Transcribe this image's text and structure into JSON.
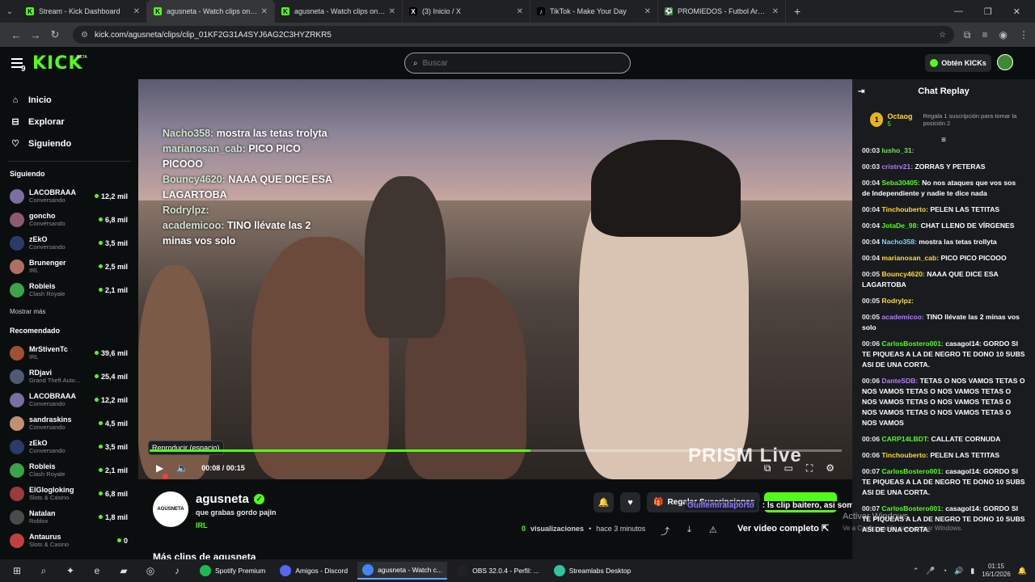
{
  "browser": {
    "tabs": [
      {
        "title": "Stream - Kick Dashboard",
        "fav_color": "#53fc18",
        "fav": "K"
      },
      {
        "title": "agusneta - Watch clips on Kick",
        "fav_color": "#53fc18",
        "fav": "K",
        "active": true
      },
      {
        "title": "agusneta - Watch clips on Kick",
        "fav_color": "#53fc18",
        "fav": "K"
      },
      {
        "title": "(3) Inicio / X",
        "fav_color": "#000000",
        "fav": "X"
      },
      {
        "title": "TikTok - Make Your Day",
        "fav_color": "#000000",
        "fav": "♪"
      },
      {
        "title": "PROMIEDOS - Futbol Argentino",
        "fav_color": "#2e9c3e",
        "fav": "⚽"
      }
    ],
    "url": "kick.com/agusneta/clips/clip_01KF2G31A4SYJ6AG2C3HYZRKR5"
  },
  "header": {
    "logo": "KICK",
    "beta": "BETA",
    "logo_num": "9",
    "search_placeholder": "Buscar",
    "kicks_label": "Obtén KICKs"
  },
  "sidebar": {
    "nav": [
      {
        "label": "Inicio",
        "icon": "home-icon",
        "glyph": "⌂"
      },
      {
        "label": "Explorar",
        "icon": "compass-icon",
        "glyph": "⊟"
      },
      {
        "label": "Siguiendo",
        "icon": "heart-icon",
        "glyph": "♡"
      }
    ],
    "following_title": "Siguiendo",
    "following": [
      {
        "name": "LACOBRAAA",
        "category": "Conversando",
        "viewers": "12,2 mil",
        "color": "#7a6fa0"
      },
      {
        "name": "goncho",
        "category": "Conversando",
        "viewers": "6,8 mil",
        "color": "#8d5a6d"
      },
      {
        "name": "zEkO",
        "category": "Conversando",
        "viewers": "3,5 mil",
        "color": "#2a3b6b"
      },
      {
        "name": "Brunenger",
        "category": "IRL",
        "viewers": "2,5 mil",
        "color": "#b07060"
      },
      {
        "name": "Robleis",
        "category": "Clash Royale",
        "viewers": "2,1 mil",
        "color": "#3ba34a"
      }
    ],
    "show_more": "Mostrar más",
    "recommended_title": "Recomendado",
    "recommended": [
      {
        "name": "MrStivenTc",
        "category": "IRL",
        "viewers": "39,6 mil",
        "color": "#a05030"
      },
      {
        "name": "RDjavi",
        "category": "Grand Theft Auto...",
        "viewers": "25,4 mil",
        "color": "#505a70"
      },
      {
        "name": "LACOBRAAA",
        "category": "Conversando",
        "viewers": "12,2 mil",
        "color": "#7a6fa0"
      },
      {
        "name": "sandraskins",
        "category": "Conversando",
        "viewers": "4,5 mil",
        "color": "#c09070"
      },
      {
        "name": "zEkO",
        "category": "Conversando",
        "viewers": "3,5 mil",
        "color": "#2a3b6b"
      },
      {
        "name": "Robleis",
        "category": "Clash Royale",
        "viewers": "2,1 mil",
        "color": "#3ba34a"
      },
      {
        "name": "ElGlogloking",
        "category": "Slots & Casino",
        "viewers": "6,8 mil",
        "color": "#9a3a3a"
      },
      {
        "name": "Natalan",
        "category": "Roblox",
        "viewers": "1,8 mil",
        "color": "#4a4a4a"
      },
      {
        "name": "Antaurus",
        "category": "Slots & Casino",
        "viewers": "0",
        "color": "#c04040"
      }
    ]
  },
  "video": {
    "overlay_chat": [
      {
        "user": "Nacho358:",
        "text": "mostra las tetas trolyta"
      },
      {
        "user": "marianosan_cab:",
        "text": "PICO PICO PICOOO"
      },
      {
        "user": "Bouncy4620:",
        "text": "NAAA QUE DICE ESA LAGARTOBA"
      },
      {
        "user": "Rodrylpz:",
        "text": ""
      },
      {
        "user": "academicoo:",
        "text": "TINO llévate las 2 minas vos solo"
      }
    ],
    "tooltip": "Reproducir (espacio)",
    "progress": 0.55,
    "time": "00:08 / 00:15",
    "watermark": "PRISM Live"
  },
  "info": {
    "streamer": "agusneta",
    "avatar_text": "AGUSNETA",
    "title": "que grabas gordo pajin",
    "category": "IRL",
    "gift_label": "Regalar Suscripciones",
    "views_num": "0",
    "views_label": "visualizaciones",
    "time_ago": "hace 3 minutos",
    "full_video": "Ver video completo",
    "more_clips": "Más clips de agusneta",
    "banner_user": "Guillemiralaporto",
    "banner_text": ": ls clip baitero, asi somos"
  },
  "chat": {
    "title": "Chat Replay",
    "pinned_user": "Octaog",
    "pinned_rank": "1",
    "pinned_sub": "5",
    "pinned_gift": "Regala 1 suscripción para tomar la posición 2",
    "messages": [
      {
        "time": "00:03",
        "user": "lusho_31:",
        "color": "#7cdd5c",
        "text": ""
      },
      {
        "time": "00:03",
        "user": "cristrv21:",
        "color": "#b57cff",
        "text": "ZORRAS Y PETERAS"
      },
      {
        "time": "00:04",
        "user": "Seba30405:",
        "color": "#53fc18",
        "text": "No nos ataques que vos sos de Independiente y nadie te dice nada"
      },
      {
        "time": "00:04",
        "user": "Tinchouberto:",
        "color": "#ffd93a",
        "text": "PELEN LAS TETITAS"
      },
      {
        "time": "00:04",
        "user": "JotaDe_98:",
        "color": "#53fc18",
        "text": "CHAT LLENO DE VÍRGENES"
      },
      {
        "time": "00:04",
        "user": "Nacho358:",
        "color": "#7cd6ff",
        "text": "mostra las tetas trollyta"
      },
      {
        "time": "00:04",
        "user": "marianosan_cab:",
        "color": "#ffd93a",
        "text": "PICO PICO PICOOO"
      },
      {
        "time": "00:05",
        "user": "Bouncy4620:",
        "color": "#ffd93a",
        "text": "NAAA QUE DICE ESA LAGARTOBA"
      },
      {
        "time": "00:05",
        "user": "Rodrylpz:",
        "color": "#ffd93a",
        "text": ""
      },
      {
        "time": "00:05",
        "user": "academicoo:",
        "color": "#b57cff",
        "text": "TINO llévate las 2 minas vos solo"
      },
      {
        "time": "00:06",
        "user": "CarlosBostero001:",
        "color": "#53fc18",
        "text": "casagol14: GORDO SI TE PIQUEAS A LA DE NEGRO TE DONO 10 SUBS ASI DE UNA CORTA."
      },
      {
        "time": "00:06",
        "user": "DanteSDB:",
        "color": "#b57cff",
        "text": "TETAS O NOS VAMOS TETAS O NOS VAMOS TETAS O NOS VAMOS TETAS O NOS VAMOS TETAS O NOS VAMOS TETAS O NOS VAMOS TETAS O NOS VAMOS TETAS O NOS VAMOS"
      },
      {
        "time": "00:06",
        "user": "CARP14LBDT:",
        "color": "#53fc18",
        "text": "CALLATE CORNUDA"
      },
      {
        "time": "00:06",
        "user": "Tinchouberto:",
        "color": "#ffd93a",
        "text": "PELEN LAS TETITAS"
      },
      {
        "time": "00:07",
        "user": "CarlosBostero001:",
        "color": "#53fc18",
        "text": "casagol14: GORDO SI TE PIQUEAS A LA DE NEGRO TE DONO 10 SUBS ASI DE UNA CORTA."
      },
      {
        "time": "00:07",
        "user": "CarlosBostero001:",
        "color": "#53fc18",
        "text": "casagol14: GORDO SI TE PIQUEAS A LA DE NEGRO TE DONO 10 SUBS ASI DE UNA CORTA."
      }
    ]
  },
  "os": {
    "activate_title": "Activar Windows",
    "activate_sub": "Ve a Configuración para activar Windows.",
    "taskbar_apps": [
      {
        "label": "Spotify Premium",
        "color": "#1db954"
      },
      {
        "label": "Amigos - Discord",
        "color": "#5865f2"
      },
      {
        "label": "agusneta - Watch c...",
        "color": "#4285f4",
        "active": true
      },
      {
        "label": "OBS 32.0.4 - Perfil: ...",
        "color": "#222222"
      },
      {
        "label": "Streamlabs Desktop",
        "color": "#31c3a2"
      }
    ],
    "time": "01:15",
    "date": "16/1/2026"
  }
}
